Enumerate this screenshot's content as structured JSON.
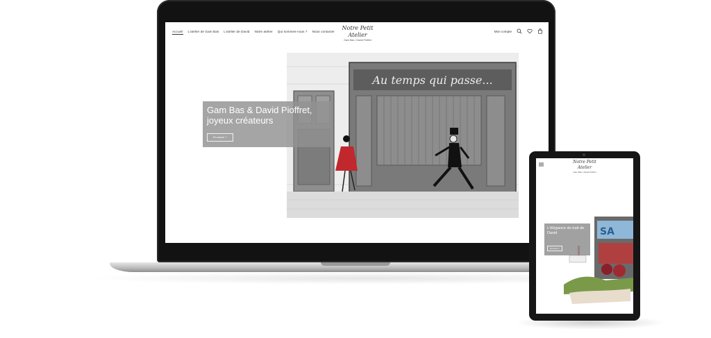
{
  "laptop": {
    "nav": {
      "links": [
        {
          "label": "Accueil",
          "active": true
        },
        {
          "label": "L'atelier de Gam Bas",
          "active": false
        },
        {
          "label": "L'atelier de David",
          "active": false
        },
        {
          "label": "Notre atelier",
          "active": false
        },
        {
          "label": "Qui sommes-nous ?",
          "active": false
        },
        {
          "label": "Nous contacter",
          "active": false
        }
      ],
      "brand": "Notre Petit Atelier",
      "brand_sub": "Gam Bas • David Pioffret",
      "account_label": "Mon compte",
      "icons": [
        "search-icon",
        "heart-icon",
        "bag-icon"
      ]
    },
    "hero": {
      "title": "Gam Bas & David Pioffret, joyeux créateurs",
      "button_label": "En savoir +",
      "sign_text": "Au temps qui passe..."
    }
  },
  "tablet": {
    "brand": "Notre Petit Atelier",
    "brand_sub": "Gam Bas • David Pioffret",
    "hero": {
      "title": "L'élégance du trait de David",
      "button_label": "En savoir +"
    }
  },
  "colors": {
    "device_frame": "#161616",
    "overlay": "#919191",
    "accent_red": "#c0282d"
  }
}
